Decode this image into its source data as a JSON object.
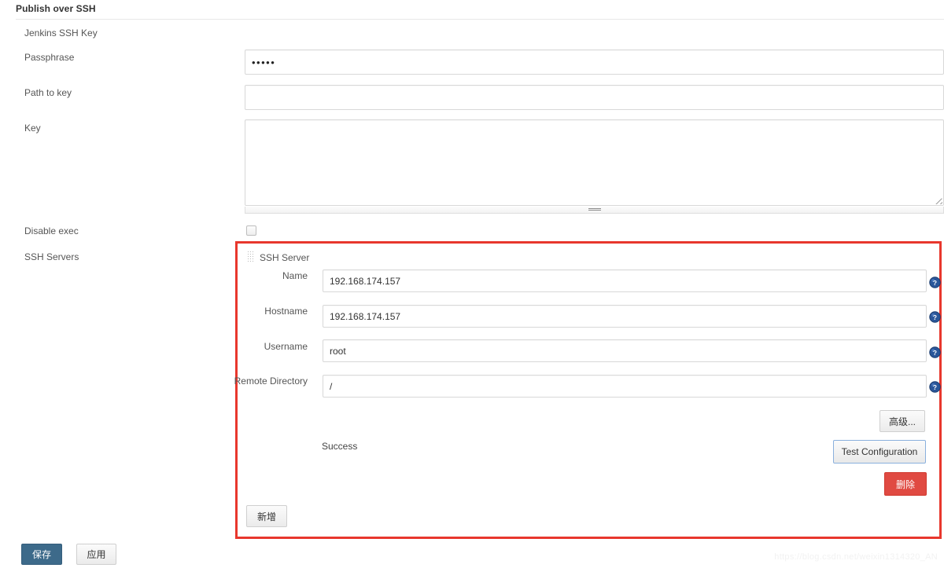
{
  "section": {
    "title": "Publish over SSH"
  },
  "rows": {
    "jenkins_ssh_key_label": "Jenkins SSH Key",
    "passphrase_label": "Passphrase",
    "passphrase_value": "•••••",
    "path_to_key_label": "Path to key",
    "path_to_key_value": "",
    "key_label": "Key",
    "key_value": "",
    "disable_exec_label": "Disable exec",
    "disable_exec_checked": false,
    "ssh_servers_label": "SSH Servers"
  },
  "ssh_server": {
    "group_title": "SSH Server",
    "fields": [
      {
        "label": "Name",
        "value": "192.168.174.157"
      },
      {
        "label": "Hostname",
        "value": "192.168.174.157"
      },
      {
        "label": "Username",
        "value": "root"
      },
      {
        "label": "Remote Directory",
        "value": "/"
      }
    ],
    "advanced_button": "高级...",
    "test_configuration_button": "Test Configuration",
    "delete_button": "删除",
    "add_button": "新增",
    "test_status": "Success"
  },
  "footer": {
    "save_button": "保存",
    "apply_button": "应用"
  },
  "watermark": "https://blog.csdn.net/weixin1314320_AN",
  "colors": {
    "highlight_border": "#e8372d",
    "delete_button_bg": "#e04a42",
    "save_button_bg": "#3d6a8a",
    "help_icon_blue": "#2a5699"
  },
  "icons": {
    "drag_grip": "drag-grip-icon",
    "help": "help-icon",
    "resize": "resize-handle-icon"
  }
}
